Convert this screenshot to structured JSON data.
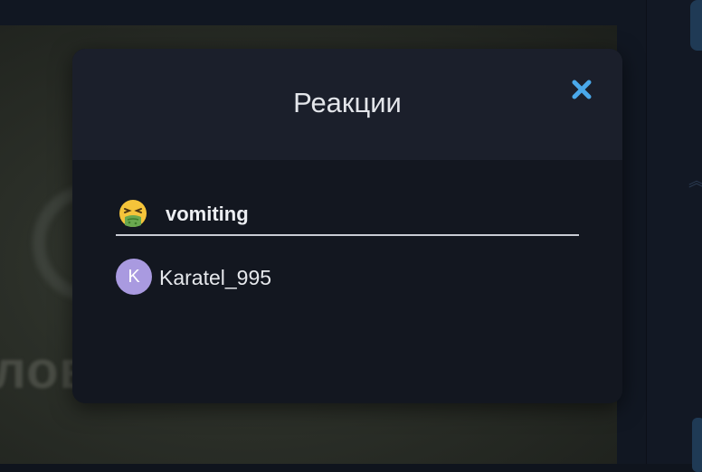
{
  "modal": {
    "title": "Реакции",
    "close_icon": "close-icon"
  },
  "reaction_tab": {
    "emoji": "nauseated-face-emoji",
    "label": "vomiting"
  },
  "users": [
    {
      "avatar_initial": "K",
      "name": "Karatel_995",
      "avatar_color": "#a99ae0"
    }
  ],
  "background": {
    "partial_text": "лов"
  },
  "colors": {
    "accent": "#4aa8ea",
    "modal_bg": "#131720",
    "header_bg": "#1b1f2b"
  }
}
